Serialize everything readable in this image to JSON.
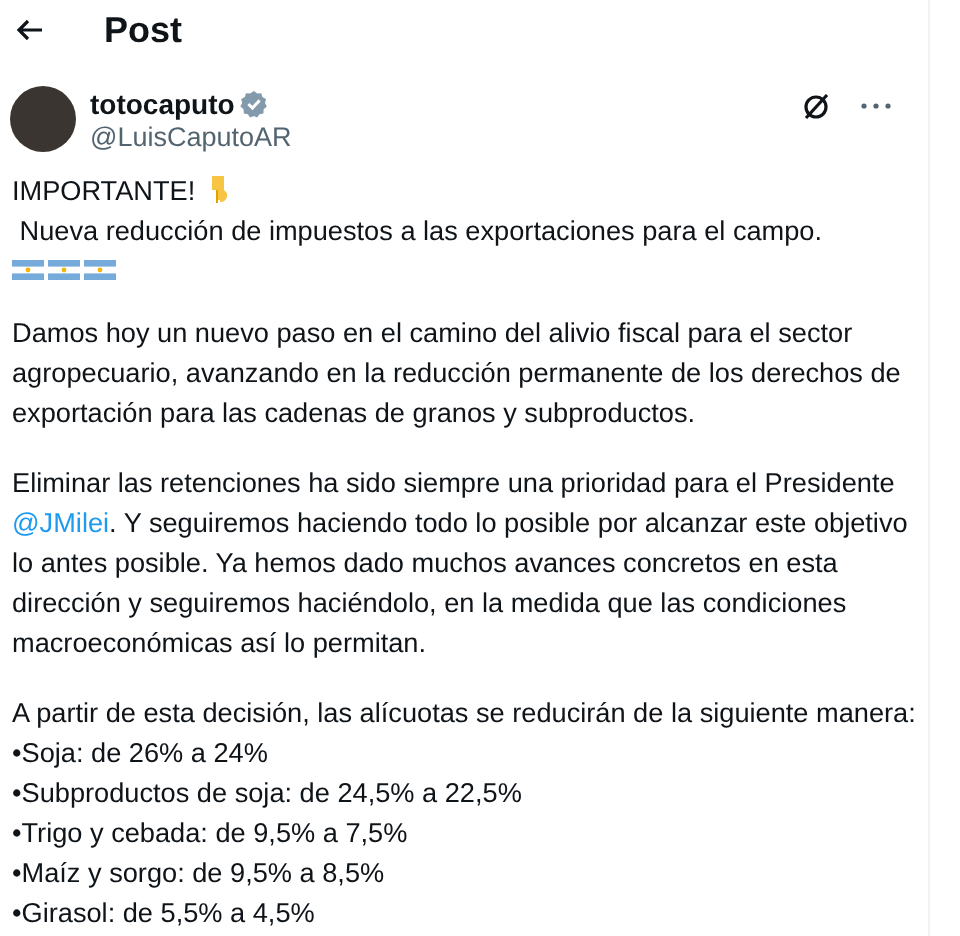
{
  "header": {
    "title": "Post"
  },
  "author": {
    "name": "totocaputo",
    "verified": true,
    "handle": "@LuisCaputoAR"
  },
  "post": {
    "headline": "IMPORTANTE!",
    "subline": " Nueva reducción de impuestos a las exportaciones para el campo.",
    "paragraphs": [
      [
        {
          "kind": "text",
          "text": "Damos hoy un nuevo paso en el camino del alivio fiscal para el sector agropecuario, avanzando en la reducción permanente de los derechos de exportación para las cadenas de granos y subproductos."
        }
      ],
      [
        {
          "kind": "text",
          "text": "Eliminar las retenciones ha sido siempre una prioridad para el Presidente "
        },
        {
          "kind": "mention",
          "text": "@JMilei"
        },
        {
          "kind": "text",
          "text": ". Y seguiremos haciendo todo lo posible por alcanzar este objetivo lo antes posible. Ya hemos dado muchos avances concretos en esta dirección y seguiremos haciéndolo, en la medida que las condiciones macroeconómicas así lo permitan."
        }
      ]
    ],
    "list_intro": "A partir de esta decisión, las alícuotas se reducirán de la siguiente manera:",
    "list_items": [
      "•Soja: de 26% a 24%",
      "•Subproductos de soja: de 24,5% a 22,5%",
      "•Trigo y cebada: de 9,5% a 7,5%",
      "•Maíz y sorgo: de 9,5% a 8,5%",
      "•Girasol: de 5,5% a 4,5%"
    ]
  }
}
